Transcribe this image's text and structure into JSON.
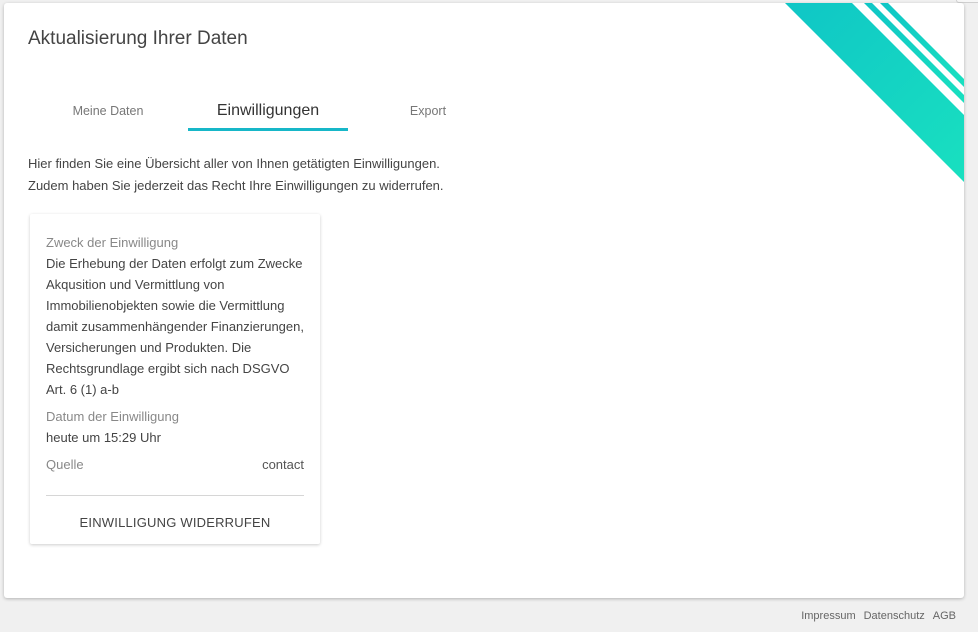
{
  "header": {
    "title": "Aktualisierung Ihrer Daten"
  },
  "tabs": [
    {
      "label": "Meine Daten",
      "active": false
    },
    {
      "label": "Einwilligungen",
      "active": true
    },
    {
      "label": "Export",
      "active": false
    }
  ],
  "intro": {
    "line1": "Hier finden Sie eine Übersicht aller von Ihnen getätigten Einwilligungen.",
    "line2": "Zudem haben Sie jederzeit das Recht Ihre Einwilligungen zu widerrufen."
  },
  "consent": {
    "purpose_label": "Zweck der Einwilligung",
    "purpose_value": "Die Erhebung der Daten erfolgt zum Zwecke Akqusition und Vermittlung von Immobilienobjekten sowie die Vermittlung damit zusammenhängender Finanzierungen, Versicherungen und Produkten. Die Rechtsgrundlage ergibt sich nach DSGVO Art. 6 (1) a-b",
    "date_label": "Datum der Einwilligung",
    "date_value": "heute um 15:29 Uhr",
    "source_label": "Quelle",
    "source_value": "contact",
    "revoke_label": "EINWILLIGUNG WIDERRUFEN"
  },
  "footer": {
    "impressum": "Impressum",
    "datenschutz": "Datenschutz",
    "agb": "AGB"
  },
  "colors": {
    "accent": "#17b7c8",
    "decor_start": "#0fc6c6",
    "decor_end": "#19e0c0"
  }
}
